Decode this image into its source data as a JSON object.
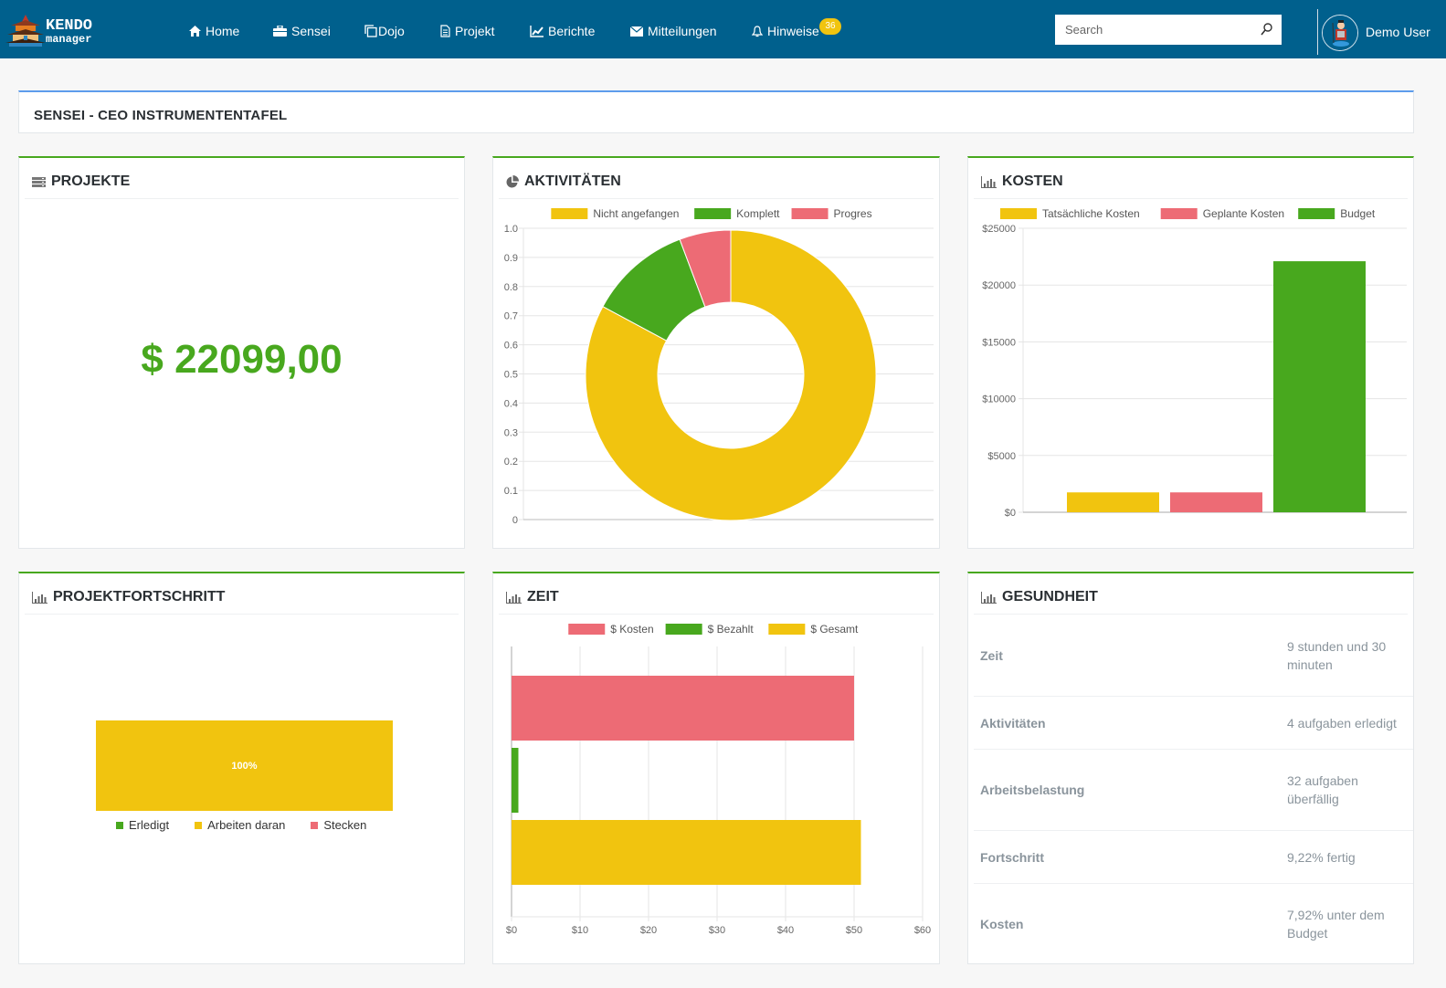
{
  "navbar": {
    "logo_text_1": "KENDO",
    "logo_text_2": "manager",
    "items": [
      {
        "label": "Home",
        "icon": "home-icon"
      },
      {
        "label": "Sensei",
        "icon": "briefcase-icon"
      },
      {
        "label": "Dojo",
        "icon": "copy-icon"
      },
      {
        "label": "Projekt",
        "icon": "document-icon"
      },
      {
        "label": "Berichte",
        "icon": "line-chart-icon"
      },
      {
        "label": "Mitteilungen",
        "icon": "envelope-icon"
      },
      {
        "label": "Hinweise",
        "icon": "bell-icon"
      }
    ],
    "notification_count": "36",
    "search_placeholder": "Search",
    "search_value": "",
    "user_name": "Demo User"
  },
  "page_title": "SENSEI - CEO INSTRUMENTENTAFEL",
  "colors": {
    "brand": "#00608d",
    "yellow": "#f1c40f",
    "green": "#48a81e",
    "red": "#ed6b75",
    "accent_blue": "#5d9cec"
  },
  "projekte": {
    "title": "PROJEKTE",
    "amount": "$ 22099,00"
  },
  "aktivitaeten": {
    "title": "AKTIVITÄTEN"
  },
  "kosten": {
    "title": "KOSTEN"
  },
  "projektfortschritt": {
    "title": "PROJEKTFORTSCHRITT",
    "segments": [
      {
        "label": "Erledigt",
        "percent": 0,
        "color": "#48a81e"
      },
      {
        "label": "Arbeiten daran",
        "percent": 100,
        "color": "#f1c40f"
      },
      {
        "label": "Stecken",
        "percent": 0,
        "color": "#ed6b75"
      }
    ],
    "bar_label": "100%"
  },
  "zeit": {
    "title": "ZEIT"
  },
  "gesundheit": {
    "title": "GESUNDHEIT",
    "rows": [
      {
        "label": "Zeit",
        "value": "9 stunden und 30 minuten"
      },
      {
        "label": "Aktivitäten",
        "value": "4 aufgaben erledigt"
      },
      {
        "label": "Arbeitsbelastung",
        "value": "32 aufgaben überfällig"
      },
      {
        "label": "Fortschritt",
        "value": "9,22% fertig"
      },
      {
        "label": "Kosten",
        "value": "7,92% unter dem Budget"
      }
    ]
  },
  "chart_data": [
    {
      "id": "aktivitaeten",
      "type": "pie",
      "subtype": "doughnut",
      "title": "AKTIVITÄTEN",
      "categories": [
        "Nicht angefangen",
        "Komplett",
        "Progres"
      ],
      "values": [
        29,
        4,
        2
      ],
      "colors": [
        "#f1c40f",
        "#48a81e",
        "#ed6b75"
      ],
      "yticks": [
        "0",
        "0.1",
        "0.2",
        "0.3",
        "0.4",
        "0.5",
        "0.6",
        "0.7",
        "0.8",
        "0.9",
        "1.0"
      ],
      "ylim": [
        0,
        1
      ],
      "legend": "top",
      "grid": true
    },
    {
      "id": "kosten",
      "type": "bar",
      "title": "KOSTEN",
      "series": [
        {
          "name": "Tatsächliche Kosten",
          "values": [
            1750
          ],
          "color": "#f1c40f"
        },
        {
          "name": "Geplante Kosten",
          "values": [
            1750
          ],
          "color": "#ed6b75"
        },
        {
          "name": "Budget",
          "values": [
            22099
          ],
          "color": "#48a81e"
        }
      ],
      "yticks": [
        "$0",
        "$5000",
        "$10000",
        "$15000",
        "$20000",
        "$25000"
      ],
      "ylim": [
        0,
        25000
      ],
      "legend": "top",
      "grid": true
    },
    {
      "id": "zeit",
      "type": "bar",
      "orientation": "horizontal",
      "title": "ZEIT",
      "series": [
        {
          "name": "$ Kosten",
          "values": [
            50
          ],
          "color": "#ed6b75"
        },
        {
          "name": "$ Bezahlt",
          "values": [
            1
          ],
          "color": "#48a81e"
        },
        {
          "name": "$ Gesamt",
          "values": [
            51
          ],
          "color": "#f1c40f"
        }
      ],
      "xticks": [
        "$0",
        "$10",
        "$20",
        "$30",
        "$40",
        "$50",
        "$60"
      ],
      "xlim": [
        0,
        60
      ],
      "legend": "top",
      "grid": true
    }
  ]
}
